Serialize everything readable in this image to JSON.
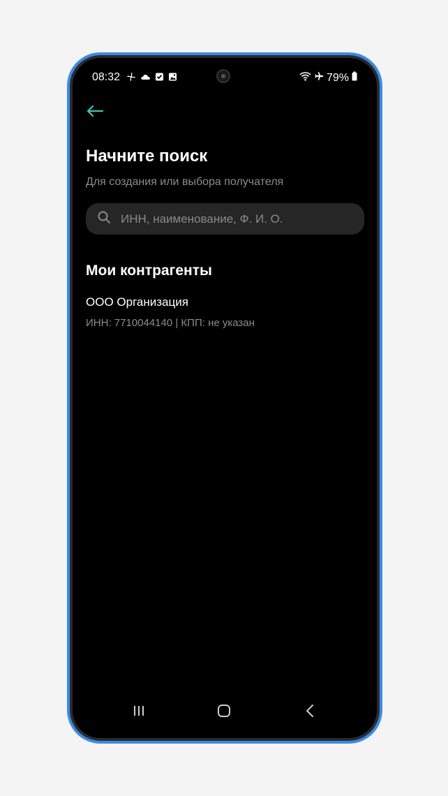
{
  "status_bar": {
    "time": "08:32",
    "battery": "79%",
    "left_icons": [
      "fan-icon",
      "cloud-icon",
      "checkbox-icon",
      "gallery-icon"
    ],
    "right_icons": [
      "wifi-icon",
      "airplane-icon",
      "battery-icon"
    ]
  },
  "header": {
    "back_icon": "arrow-left-icon",
    "accent_color": "#3ec7b6"
  },
  "main": {
    "title": "Начните поиск",
    "subtitle": "Для создания или выбора получателя",
    "search": {
      "placeholder": "ИНН, наименование, Ф. И. О.",
      "value": ""
    },
    "section_title": "Мои контрагенты",
    "counterparties": [
      {
        "name": "ООО Организация",
        "details": "ИНН: 7710044140 | КПП: не указан"
      }
    ]
  },
  "nav_bar": {
    "buttons": [
      "recent-apps-icon",
      "home-icon",
      "back-nav-icon"
    ]
  },
  "colors": {
    "frame": "#3b8be6",
    "screen_bg": "#000000",
    "search_bg": "#262626",
    "secondary_text": "#8c8c8c"
  }
}
